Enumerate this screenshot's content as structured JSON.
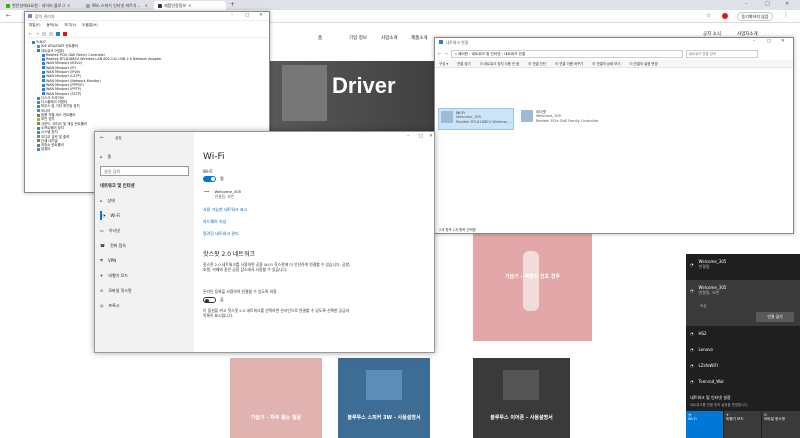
{
  "browser": {
    "tabs": [
      {
        "label": "천안성애요요원 : 네이버 블로그",
        "favicon_color": "#2db400"
      },
      {
        "label": "Win 스위치 인터넷 파트치료법",
        "favicon_color": "#9aa0a6"
      },
      {
        "label": "제품안정정보",
        "favicon_color": "#333333"
      }
    ],
    "new_tab": "+",
    "profile_label": "동기화하지 않음",
    "accent_red": "#e81123"
  },
  "site": {
    "nav": [
      "홈",
      "기업 정보",
      "사업소개",
      "제품소개",
      "고객지원"
    ],
    "top_links": [
      "공지 소식",
      "사업자소개"
    ],
    "hero_text": "Driver",
    "cards": [
      {
        "title": "가습기 - 적정이 건조 경우",
        "bg": "#e3a6a9"
      },
      {
        "title": "가습기 - 자주 묻는 질문",
        "bg": "#e1b3b0"
      },
      {
        "title": "블루투스 스피커 3W - 사용설명서",
        "bg": "#3d6d95"
      },
      {
        "title": "블루투스 이어폰 - 사용설명서",
        "bg": "#3a3a3a"
      }
    ]
  },
  "devmgr": {
    "title": "장치 관리자",
    "menu": [
      "파일(F)",
      "동작(A)",
      "보기(V)",
      "도움말(H)"
    ],
    "tree": [
      {
        "label": "YUKI7",
        "depth": 0,
        "color": "#3b7bd6"
      },
      {
        "label": "IDE ATA/ATAPI 컨트롤러",
        "depth": 1,
        "color": "#6d8fb3"
      },
      {
        "label": "네트워크 어댑터",
        "depth": 1,
        "color": "#2d7dd2"
      },
      {
        "label": "Realtek PCIe GbE Family Controller",
        "depth": 2,
        "color": "#2d7dd2"
      },
      {
        "label": "Realtek RTL8188EU Wireless LAN 802.11n USB 2.0 Network Adapter",
        "depth": 2,
        "color": "#2d7dd2"
      },
      {
        "label": "WAN Miniport (IKEv2)",
        "depth": 2,
        "color": "#2d7dd2"
      },
      {
        "label": "WAN Miniport (IP)",
        "depth": 2,
        "color": "#2d7dd2"
      },
      {
        "label": "WAN Miniport (IPv6)",
        "depth": 2,
        "color": "#2d7dd2"
      },
      {
        "label": "WAN Miniport (L2TP)",
        "depth": 2,
        "color": "#2d7dd2"
      },
      {
        "label": "WAN Miniport (Network Monitor)",
        "depth": 2,
        "color": "#2d7dd2"
      },
      {
        "label": "WAN Miniport (PPPOE)",
        "depth": 2,
        "color": "#2d7dd2"
      },
      {
        "label": "WAN Miniport (PPTP)",
        "depth": 2,
        "color": "#2d7dd2"
      },
      {
        "label": "WAN Miniport (SSTP)",
        "depth": 2,
        "color": "#2d7dd2"
      },
      {
        "label": "디스크 드라이브",
        "depth": 1,
        "color": "#777777"
      },
      {
        "label": "디스플레이 어댑터",
        "depth": 1,
        "color": "#3a8ad6"
      },
      {
        "label": "마우스 및 기타 포인팅 장치",
        "depth": 1,
        "color": "#777777"
      },
      {
        "label": "모니터",
        "depth": 1,
        "color": "#3a8ad6"
      },
      {
        "label": "범용 직렬 버스 컨트롤러",
        "depth": 1,
        "color": "#777777"
      },
      {
        "label": "보안 장치",
        "depth": 1,
        "color": "#c8a232"
      },
      {
        "label": "사운드, 비디오 및 게임 컨트롤러",
        "depth": 1,
        "color": "#6a9a4a"
      },
      {
        "label": "소프트웨어 장치",
        "depth": 1,
        "color": "#777777"
      },
      {
        "label": "시스템 장치",
        "depth": 1,
        "color": "#3a8ad6"
      },
      {
        "label": "오디오 입력 및 출력",
        "depth": 1,
        "color": "#6a9a4a"
      },
      {
        "label": "인쇄 대기열",
        "depth": 1,
        "color": "#777777"
      },
      {
        "label": "저장소 컨트롤러",
        "depth": 1,
        "color": "#777777"
      },
      {
        "label": "컴퓨터",
        "depth": 1,
        "color": "#3a8ad6"
      }
    ]
  },
  "netconn": {
    "title": "네트워크 연결",
    "breadcrumb": "« 제어판 › 네트워크 및 인터넷 › 네트워크 연결",
    "search_placeholder": "네트워크 연결 검색",
    "toolbar": [
      "구성 ▾",
      "연결 끊기",
      "이 네트워크 장치 사용 안 함",
      "이 연결 진단",
      "이 연결 이름 바꾸기",
      "이 연결의 상태 보기",
      "이 연결의 설정 변경"
    ],
    "adapters": [
      {
        "name": "Wi-Fi",
        "network": "Welcome_305",
        "device": "Realtek RTL8188EU Wireless LAN ..."
      },
      {
        "name": "이더넷",
        "network": "Welcome_305",
        "device": "Realtek PCIe GbE Family Controller"
      }
    ],
    "status": "2개 항목    1개 항목 선택함"
  },
  "settings": {
    "title": "설정",
    "home_label": "홈",
    "search_placeholder": "설정 검색",
    "category": "네트워크 및 인터넷",
    "nav": [
      "상태",
      "Wi-Fi",
      "이더넷",
      "전화 접속",
      "VPN",
      "비행기 모드",
      "모바일 핫스팟",
      "프록시"
    ],
    "page_title": "Wi-Fi",
    "wifi_label": "Wi-Fi",
    "wifi_state": "켬",
    "network_name": "Welcome_305",
    "network_status": "연결됨, 보안",
    "links": [
      "사용 가능한 네트워크 표시",
      "하드웨어 속성",
      "알려진 네트워크 관리"
    ],
    "hotspot_title": "핫스팟 2.0 네트워크",
    "hotspot_desc": "핫스팟 2.0 네트워크를 사용하면 공용 Wi-Fi 핫스팟에 더 안전하게 연결할 수 있습니다. 공항, 호텔, 카페와 같은 공용 장소에서 사용할 수 있습니다.",
    "hotspot_toggle_label": "온라인 등록을 사용하여 연결할 수 있도록 허용",
    "hotspot_state": "끔",
    "hotspot_footer": "이 옵션을 켜고 핫스팟 2.0 네트워크를 선택하면 온라인으로 연결할 수 있도록 선택한 공급자 목록이 표시됩니다."
  },
  "flyout": {
    "networks": [
      {
        "name": "Welcome_305",
        "status": "연결됨"
      },
      {
        "name": "Welcome_305",
        "status": "연결됨, 보안"
      },
      {
        "name": "HS2",
        "status": ""
      },
      {
        "name": "Lenovo",
        "status": ""
      },
      {
        "name": "LZsfeWIFI",
        "status": ""
      },
      {
        "name": "Teenrod_War",
        "status": ""
      }
    ],
    "connect_button": "연결 끊기",
    "status_label": "속성",
    "settings_title": "네트워크 및 인터넷 설정",
    "settings_desc": "네트워크를 연결 등의 설정을 변경합니다.",
    "quick_actions": [
      "Wi-Fi",
      "비행기 모드",
      "모바일 핫스팟"
    ],
    "accent": "#0078d7"
  }
}
